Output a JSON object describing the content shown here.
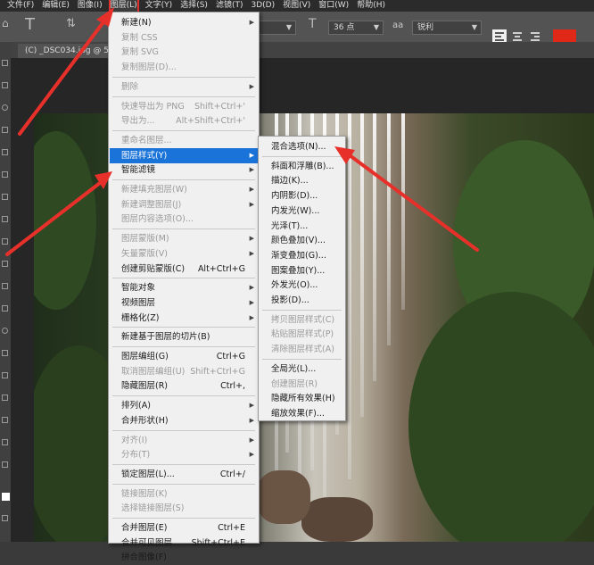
{
  "menubar": [
    "文件(F)",
    "编辑(E)",
    "图像(I)",
    "图层(L)",
    "文字(Y)",
    "选择(S)",
    "滤镜(T)",
    "3D(D)",
    "视图(V)",
    "窗口(W)",
    "帮助(H)"
  ],
  "options": {
    "font_size": "36 点",
    "aa_icon": "aa",
    "antialias": "锐利"
  },
  "document_tab": "(C) _DSC034",
  "document_tab_rest": ".jpg @ 50",
  "layer_menu": [
    {
      "label": "新建(N)",
      "shortcut": "",
      "sub": true,
      "dis": false
    },
    {
      "label": "复制 CSS",
      "shortcut": "",
      "sub": false,
      "dis": true
    },
    {
      "label": "复制 SVG",
      "shortcut": "",
      "sub": false,
      "dis": true
    },
    {
      "label": "复制图层(D)...",
      "shortcut": "",
      "sub": false,
      "dis": true
    },
    {
      "sep": true
    },
    {
      "label": "删除",
      "shortcut": "",
      "sub": true,
      "dis": true
    },
    {
      "sep": true
    },
    {
      "label": "快速导出为 PNG",
      "shortcut": "Shift+Ctrl+'",
      "sub": false,
      "dis": true
    },
    {
      "label": "导出为...",
      "shortcut": "Alt+Shift+Ctrl+'",
      "sub": false,
      "dis": true
    },
    {
      "sep": true
    },
    {
      "label": "重命名图层...",
      "shortcut": "",
      "sub": false,
      "dis": true
    },
    {
      "label": "图层样式(Y)",
      "shortcut": "",
      "sub": true,
      "dis": false,
      "hl": true
    },
    {
      "label": "智能滤镜",
      "shortcut": "",
      "sub": true,
      "dis": false
    },
    {
      "sep": true
    },
    {
      "label": "新建填充图层(W)",
      "shortcut": "",
      "sub": true,
      "dis": true
    },
    {
      "label": "新建调整图层(J)",
      "shortcut": "",
      "sub": true,
      "dis": true
    },
    {
      "label": "图层内容选项(O)...",
      "shortcut": "",
      "sub": false,
      "dis": true
    },
    {
      "sep": true
    },
    {
      "label": "图层蒙版(M)",
      "shortcut": "",
      "sub": true,
      "dis": true
    },
    {
      "label": "矢量蒙版(V)",
      "shortcut": "",
      "sub": true,
      "dis": true
    },
    {
      "label": "创建剪贴蒙版(C)",
      "shortcut": "Alt+Ctrl+G",
      "sub": false,
      "dis": false
    },
    {
      "sep": true
    },
    {
      "label": "智能对象",
      "shortcut": "",
      "sub": true,
      "dis": false
    },
    {
      "label": "视频图层",
      "shortcut": "",
      "sub": true,
      "dis": false
    },
    {
      "label": "栅格化(Z)",
      "shortcut": "",
      "sub": true,
      "dis": false
    },
    {
      "sep": true
    },
    {
      "label": "新建基于图层的切片(B)",
      "shortcut": "",
      "sub": false,
      "dis": false
    },
    {
      "sep": true
    },
    {
      "label": "图层编组(G)",
      "shortcut": "Ctrl+G",
      "sub": false,
      "dis": false
    },
    {
      "label": "取消图层编组(U)",
      "shortcut": "Shift+Ctrl+G",
      "sub": false,
      "dis": true
    },
    {
      "label": "隐藏图层(R)",
      "shortcut": "Ctrl+,",
      "sub": false,
      "dis": false
    },
    {
      "sep": true
    },
    {
      "label": "排列(A)",
      "shortcut": "",
      "sub": true,
      "dis": false
    },
    {
      "label": "合并形状(H)",
      "shortcut": "",
      "sub": true,
      "dis": false
    },
    {
      "sep": true
    },
    {
      "label": "对齐(I)",
      "shortcut": "",
      "sub": true,
      "dis": true
    },
    {
      "label": "分布(T)",
      "shortcut": "",
      "sub": true,
      "dis": true
    },
    {
      "sep": true
    },
    {
      "label": "锁定图层(L)...",
      "shortcut": "Ctrl+/",
      "sub": false,
      "dis": false
    },
    {
      "sep": true
    },
    {
      "label": "链接图层(K)",
      "shortcut": "",
      "sub": false,
      "dis": true
    },
    {
      "label": "选择链接图层(S)",
      "shortcut": "",
      "sub": false,
      "dis": true
    },
    {
      "sep": true
    },
    {
      "label": "合并图层(E)",
      "shortcut": "Ctrl+E",
      "sub": false,
      "dis": false
    },
    {
      "label": "合并可见图层",
      "shortcut": "Shift+Ctrl+E",
      "sub": false,
      "dis": false
    },
    {
      "label": "拼合图像(F)",
      "shortcut": "",
      "sub": false,
      "dis": false
    }
  ],
  "style_menu": [
    {
      "label": "混合选项(N)...",
      "dis": false
    },
    {
      "sep": true
    },
    {
      "label": "斜面和浮雕(B)...",
      "dis": false
    },
    {
      "label": "描边(K)...",
      "dis": false
    },
    {
      "label": "内阴影(D)...",
      "dis": false
    },
    {
      "label": "内发光(W)...",
      "dis": false
    },
    {
      "label": "光泽(T)...",
      "dis": false
    },
    {
      "label": "颜色叠加(V)...",
      "dis": false
    },
    {
      "label": "渐变叠加(G)...",
      "dis": false
    },
    {
      "label": "图案叠加(Y)...",
      "dis": false
    },
    {
      "label": "外发光(O)...",
      "dis": false
    },
    {
      "label": "投影(D)...",
      "dis": false
    },
    {
      "sep": true
    },
    {
      "label": "拷贝图层样式(C)",
      "dis": true
    },
    {
      "label": "粘贴图层样式(P)",
      "dis": true
    },
    {
      "label": "清除图层样式(A)",
      "dis": true
    },
    {
      "sep": true
    },
    {
      "label": "全局光(L)...",
      "dis": false
    },
    {
      "label": "创建图层(R)",
      "dis": true
    },
    {
      "label": "隐藏所有效果(H)",
      "dis": false
    },
    {
      "label": "缩放效果(F)...",
      "dis": false
    }
  ],
  "colors": {
    "highlight": "#1a73d9",
    "annotation_arrow": "#e8302a",
    "swatch": "#e02818"
  }
}
